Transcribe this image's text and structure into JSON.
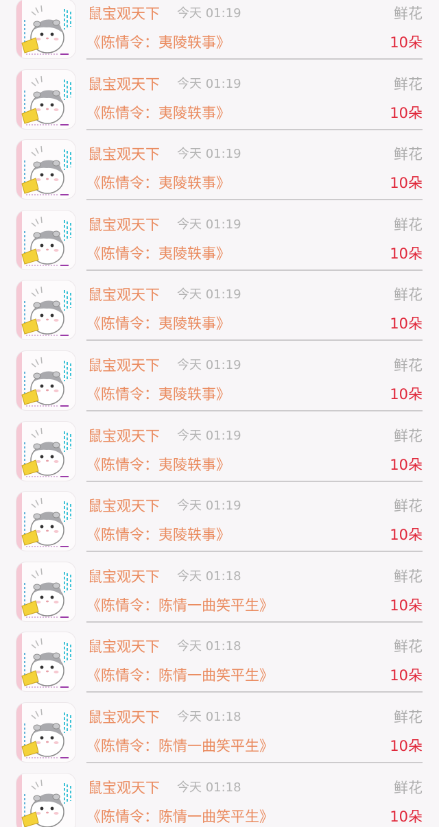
{
  "records": [
    {
      "user": "鼠宝观天下",
      "time": "今天 01:19",
      "gift": "鲜花",
      "book": "《陈情令：夷陵轶事》",
      "amount": "10朵"
    },
    {
      "user": "鼠宝观天下",
      "time": "今天 01:19",
      "gift": "鲜花",
      "book": "《陈情令：夷陵轶事》",
      "amount": "10朵"
    },
    {
      "user": "鼠宝观天下",
      "time": "今天 01:19",
      "gift": "鲜花",
      "book": "《陈情令：夷陵轶事》",
      "amount": "10朵"
    },
    {
      "user": "鼠宝观天下",
      "time": "今天 01:19",
      "gift": "鲜花",
      "book": "《陈情令：夷陵轶事》",
      "amount": "10朵"
    },
    {
      "user": "鼠宝观天下",
      "time": "今天 01:19",
      "gift": "鲜花",
      "book": "《陈情令：夷陵轶事》",
      "amount": "10朵"
    },
    {
      "user": "鼠宝观天下",
      "time": "今天 01:19",
      "gift": "鲜花",
      "book": "《陈情令：夷陵轶事》",
      "amount": "10朵"
    },
    {
      "user": "鼠宝观天下",
      "time": "今天 01:19",
      "gift": "鲜花",
      "book": "《陈情令：夷陵轶事》",
      "amount": "10朵"
    },
    {
      "user": "鼠宝观天下",
      "time": "今天 01:19",
      "gift": "鲜花",
      "book": "《陈情令：夷陵轶事》",
      "amount": "10朵"
    },
    {
      "user": "鼠宝观天下",
      "time": "今天 01:18",
      "gift": "鲜花",
      "book": "《陈情令：陈情一曲笑平生》",
      "amount": "10朵"
    },
    {
      "user": "鼠宝观天下",
      "time": "今天 01:18",
      "gift": "鲜花",
      "book": "《陈情令：陈情一曲笑平生》",
      "amount": "10朵"
    },
    {
      "user": "鼠宝观天下",
      "time": "今天 01:18",
      "gift": "鲜花",
      "book": "《陈情令：陈情一曲笑平生》",
      "amount": "10朵"
    },
    {
      "user": "鼠宝观天下",
      "time": "今天 01:18",
      "gift": "鲜花",
      "book": "《陈情令：陈情一曲笑平生》",
      "amount": "10朵"
    }
  ],
  "avatar_icon": "hamster-avatar-icon",
  "colors": {
    "background": "#f8f6f8",
    "nickname": "#ea8b5f",
    "book_title": "#ea8b5f",
    "timestamp": "#b3b3b3",
    "gift_type": "#adadad",
    "amount": "#e0273a",
    "divider": "#cdcbcd"
  }
}
